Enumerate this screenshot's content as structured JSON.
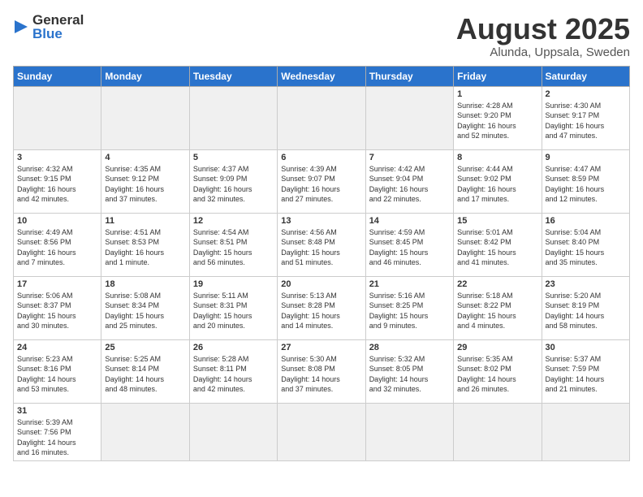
{
  "logo": {
    "general": "General",
    "blue": "Blue"
  },
  "title": "August 2025",
  "subtitle": "Alunda, Uppsala, Sweden",
  "days_of_week": [
    "Sunday",
    "Monday",
    "Tuesday",
    "Wednesday",
    "Thursday",
    "Friday",
    "Saturday"
  ],
  "weeks": [
    [
      {
        "day": "",
        "info": ""
      },
      {
        "day": "",
        "info": ""
      },
      {
        "day": "",
        "info": ""
      },
      {
        "day": "",
        "info": ""
      },
      {
        "day": "",
        "info": ""
      },
      {
        "day": "1",
        "info": "Sunrise: 4:28 AM\nSunset: 9:20 PM\nDaylight: 16 hours\nand 52 minutes."
      },
      {
        "day": "2",
        "info": "Sunrise: 4:30 AM\nSunset: 9:17 PM\nDaylight: 16 hours\nand 47 minutes."
      }
    ],
    [
      {
        "day": "3",
        "info": "Sunrise: 4:32 AM\nSunset: 9:15 PM\nDaylight: 16 hours\nand 42 minutes."
      },
      {
        "day": "4",
        "info": "Sunrise: 4:35 AM\nSunset: 9:12 PM\nDaylight: 16 hours\nand 37 minutes."
      },
      {
        "day": "5",
        "info": "Sunrise: 4:37 AM\nSunset: 9:09 PM\nDaylight: 16 hours\nand 32 minutes."
      },
      {
        "day": "6",
        "info": "Sunrise: 4:39 AM\nSunset: 9:07 PM\nDaylight: 16 hours\nand 27 minutes."
      },
      {
        "day": "7",
        "info": "Sunrise: 4:42 AM\nSunset: 9:04 PM\nDaylight: 16 hours\nand 22 minutes."
      },
      {
        "day": "8",
        "info": "Sunrise: 4:44 AM\nSunset: 9:02 PM\nDaylight: 16 hours\nand 17 minutes."
      },
      {
        "day": "9",
        "info": "Sunrise: 4:47 AM\nSunset: 8:59 PM\nDaylight: 16 hours\nand 12 minutes."
      }
    ],
    [
      {
        "day": "10",
        "info": "Sunrise: 4:49 AM\nSunset: 8:56 PM\nDaylight: 16 hours\nand 7 minutes."
      },
      {
        "day": "11",
        "info": "Sunrise: 4:51 AM\nSunset: 8:53 PM\nDaylight: 16 hours\nand 1 minute."
      },
      {
        "day": "12",
        "info": "Sunrise: 4:54 AM\nSunset: 8:51 PM\nDaylight: 15 hours\nand 56 minutes."
      },
      {
        "day": "13",
        "info": "Sunrise: 4:56 AM\nSunset: 8:48 PM\nDaylight: 15 hours\nand 51 minutes."
      },
      {
        "day": "14",
        "info": "Sunrise: 4:59 AM\nSunset: 8:45 PM\nDaylight: 15 hours\nand 46 minutes."
      },
      {
        "day": "15",
        "info": "Sunrise: 5:01 AM\nSunset: 8:42 PM\nDaylight: 15 hours\nand 41 minutes."
      },
      {
        "day": "16",
        "info": "Sunrise: 5:04 AM\nSunset: 8:40 PM\nDaylight: 15 hours\nand 35 minutes."
      }
    ],
    [
      {
        "day": "17",
        "info": "Sunrise: 5:06 AM\nSunset: 8:37 PM\nDaylight: 15 hours\nand 30 minutes."
      },
      {
        "day": "18",
        "info": "Sunrise: 5:08 AM\nSunset: 8:34 PM\nDaylight: 15 hours\nand 25 minutes."
      },
      {
        "day": "19",
        "info": "Sunrise: 5:11 AM\nSunset: 8:31 PM\nDaylight: 15 hours\nand 20 minutes."
      },
      {
        "day": "20",
        "info": "Sunrise: 5:13 AM\nSunset: 8:28 PM\nDaylight: 15 hours\nand 14 minutes."
      },
      {
        "day": "21",
        "info": "Sunrise: 5:16 AM\nSunset: 8:25 PM\nDaylight: 15 hours\nand 9 minutes."
      },
      {
        "day": "22",
        "info": "Sunrise: 5:18 AM\nSunset: 8:22 PM\nDaylight: 15 hours\nand 4 minutes."
      },
      {
        "day": "23",
        "info": "Sunrise: 5:20 AM\nSunset: 8:19 PM\nDaylight: 14 hours\nand 58 minutes."
      }
    ],
    [
      {
        "day": "24",
        "info": "Sunrise: 5:23 AM\nSunset: 8:16 PM\nDaylight: 14 hours\nand 53 minutes."
      },
      {
        "day": "25",
        "info": "Sunrise: 5:25 AM\nSunset: 8:14 PM\nDaylight: 14 hours\nand 48 minutes."
      },
      {
        "day": "26",
        "info": "Sunrise: 5:28 AM\nSunset: 8:11 PM\nDaylight: 14 hours\nand 42 minutes."
      },
      {
        "day": "27",
        "info": "Sunrise: 5:30 AM\nSunset: 8:08 PM\nDaylight: 14 hours\nand 37 minutes."
      },
      {
        "day": "28",
        "info": "Sunrise: 5:32 AM\nSunset: 8:05 PM\nDaylight: 14 hours\nand 32 minutes."
      },
      {
        "day": "29",
        "info": "Sunrise: 5:35 AM\nSunset: 8:02 PM\nDaylight: 14 hours\nand 26 minutes."
      },
      {
        "day": "30",
        "info": "Sunrise: 5:37 AM\nSunset: 7:59 PM\nDaylight: 14 hours\nand 21 minutes."
      }
    ],
    [
      {
        "day": "31",
        "info": "Sunrise: 5:39 AM\nSunset: 7:56 PM\nDaylight: 14 hours\nand 16 minutes."
      },
      {
        "day": "",
        "info": ""
      },
      {
        "day": "",
        "info": ""
      },
      {
        "day": "",
        "info": ""
      },
      {
        "day": "",
        "info": ""
      },
      {
        "day": "",
        "info": ""
      },
      {
        "day": "",
        "info": ""
      }
    ]
  ]
}
